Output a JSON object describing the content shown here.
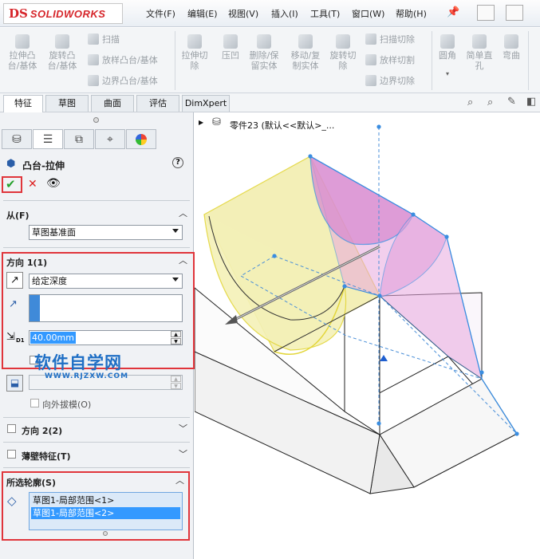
{
  "app": {
    "logo_ds": "DS",
    "logo_text": "SOLIDWORKS"
  },
  "menu": [
    "文件(F)",
    "编辑(E)",
    "视图(V)",
    "插入(I)",
    "工具(T)",
    "窗口(W)",
    "帮助(H)"
  ],
  "ribbon": {
    "extrude_boss": "拉伸凸\n台/基体",
    "revolve_boss": "旋转凸\n台/基体",
    "sweep": "扫描",
    "loft": "放样凸台/基体",
    "boundary": "边界凸台/基体",
    "extrude_cut": "拉伸切\n除",
    "indent": "压凹",
    "delete_keep": "删除/保\n留实体",
    "move_copy": "移动/复\n制实体",
    "revolve_cut": "旋转切\n除",
    "swept_cut": "扫描切除",
    "lofted_cut": "放样切割",
    "boundary_cut": "边界切除",
    "fillet": "圆角",
    "simple_hole": "简单直\n孔",
    "wrap": "弯曲"
  },
  "tabs": [
    "特征",
    "草图",
    "曲面",
    "评估",
    "DimXpert"
  ],
  "tree": {
    "part_label": "零件23  (默认<<默认>_..."
  },
  "panel": {
    "feature_title": "凸台-拉伸",
    "from_label": "从(F)",
    "from_value": "草图基准面",
    "dir1_label": "方向 1(1)",
    "end_condition": "给定深度",
    "depth": "40.00mm",
    "draft_outward": "向外拔模(O)",
    "dir2_label": "方向 2(2)",
    "thin_label": "薄壁特征(T)",
    "contours_label": "所选轮廓(S)",
    "contours": [
      "草图1-局部范围<1>",
      "草图1-局部范围<2>"
    ]
  },
  "watermark": {
    "cn": "软件自学网",
    "en": "WWW.RJZXW.COM"
  }
}
